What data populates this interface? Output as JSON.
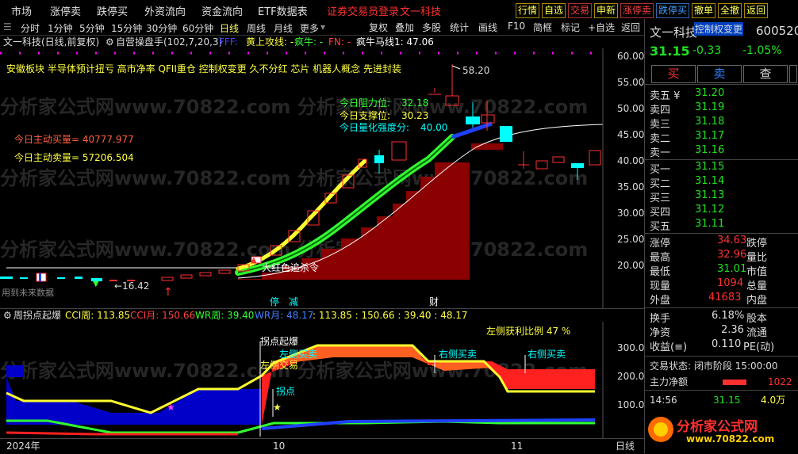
{
  "menu": {
    "items": [
      "市场",
      "涨停卖",
      "跌停买",
      "外资流向",
      "资金流向",
      "ETF数据表"
    ],
    "alert": "证券交易员登录",
    "alert2": "文一科技",
    "buttons": [
      "行情",
      "自选",
      "交易",
      "申新",
      "涨停卖",
      "跌停买",
      "撤单",
      "全撤",
      "返回"
    ]
  },
  "periods": {
    "items": [
      "分时",
      "1分钟",
      "5分钟",
      "15分钟",
      "30分钟",
      "60分钟",
      "日线",
      "周线",
      "月线",
      "更多"
    ],
    "active": "日线",
    "right": [
      "复权",
      "叠加",
      "多股",
      "统计",
      "画线",
      "F10",
      "简框",
      "标记",
      "+自选",
      "返回"
    ]
  },
  "info": {
    "stock": "文一科技(日线,前复权)",
    "formula": "自营操盘手(102,7,20,3)",
    "fff": "FFF:",
    "yellow_line": "黄上攻线: -",
    "green_line": "疯牛: -",
    "fn": "FN: -",
    "horse": "疯牛马线1: 47.06"
  },
  "main": {
    "concepts": "安徽板块  半导体预计扭亏  高市净率  QFII重仓  控制权变更  久不分红   芯片  机器人概念  先进封装",
    "buy_active": "今日主动买量= 40777.977",
    "sell_active": "今日主动卖量= 57206.504",
    "resistance": "今日阻力位:",
    "resistance_val": "32.18",
    "support": "今日支撑位:",
    "support_val": "30.23",
    "strength": "今日量化强度分:",
    "strength_val": "40.00",
    "high_marker": "58.20",
    "low_marker": "←16.42",
    "kill_label": "大红色追杀令",
    "future_label": "用到未来数据",
    "tag_ting": "停",
    "tag_jian": "减",
    "tag_cai": "财",
    "yaxis": [
      "60.00",
      "55.00",
      "50.00",
      "45.00",
      "40.00",
      "35.00",
      "30.00",
      "25.00",
      "20.00"
    ]
  },
  "sub": {
    "title": "周拐点起爆",
    "cci_week": "CCI周: 113.85",
    "cci_month": "CCI月: 150.66",
    "wr_week": "WR周: 39.40",
    "wr_month": "WR月: 48.17",
    "vals": ": 113.85 : 150.66 : 39.40 : 48.17",
    "profit_ratio": "左侧获利比例  47 %",
    "lbl_guaidian_boom": "拐点起爆",
    "lbl_left_buy": "左侧买卖",
    "lbl_left_trade": "左侧交易",
    "lbl_guaidian": "拐点",
    "lbl_right_buy1": "右侧买卖",
    "lbl_right_buy2": "右侧买卖",
    "yaxis": [
      "300.0",
      "200.0",
      "100.0"
    ]
  },
  "bottom": {
    "year": "2024年",
    "m10": "10",
    "m11": "11",
    "end": "日线"
  },
  "panel": {
    "name": "文一科技",
    "code": "600520",
    "tag": "控制权变更",
    "price": "31.15",
    "change": "-0.33",
    "pct": "-1.05%",
    "buy_btn": "买",
    "sell_btn": "卖",
    "query_btn": "查",
    "asks": [
      {
        "label": "卖五 ¥",
        "price": "31.20"
      },
      {
        "label": "卖四",
        "price": "31.19"
      },
      {
        "label": "卖三",
        "price": "31.18"
      },
      {
        "label": "卖二",
        "price": "31.17"
      },
      {
        "label": "卖一",
        "price": "31.16"
      }
    ],
    "bids": [
      {
        "label": "买一",
        "price": "31.15"
      },
      {
        "label": "买二",
        "price": "31.14"
      },
      {
        "label": "买三",
        "price": "31.13"
      },
      {
        "label": "买四",
        "price": "31.12"
      },
      {
        "label": "买五",
        "price": "31.11"
      }
    ],
    "stats": [
      {
        "l1": "涨停",
        "v1": "34.63",
        "l2": "跌停"
      },
      {
        "l1": "最高",
        "v1": "32.96",
        "l2": "量比"
      },
      {
        "l1": "最低",
        "v1": "31.01",
        "l2": "市值"
      },
      {
        "l1": "现量",
        "v1": "1094",
        "l2": "总量"
      },
      {
        "l1": "外盘",
        "v1": "41683",
        "l2": "内盘"
      }
    ],
    "stats2": [
      {
        "l1": "换手",
        "v1": "6.18%",
        "l2": "股本"
      },
      {
        "l1": "净资",
        "v1": "2.36",
        "l2": "流通"
      },
      {
        "l1": "收益(≡)",
        "v1": "0.110",
        "l2": "PE(动)"
      }
    ],
    "trade_state": "交易状态: 闭市阶段 15:00:00",
    "netflow_label": "主力净额",
    "netflow_val": "1022",
    "tick_time": "14:56",
    "tick_price": "31.15",
    "tick_vol": "4.0万",
    "logo": "分析家公式网",
    "logo_url": "www.70822.com"
  }
}
